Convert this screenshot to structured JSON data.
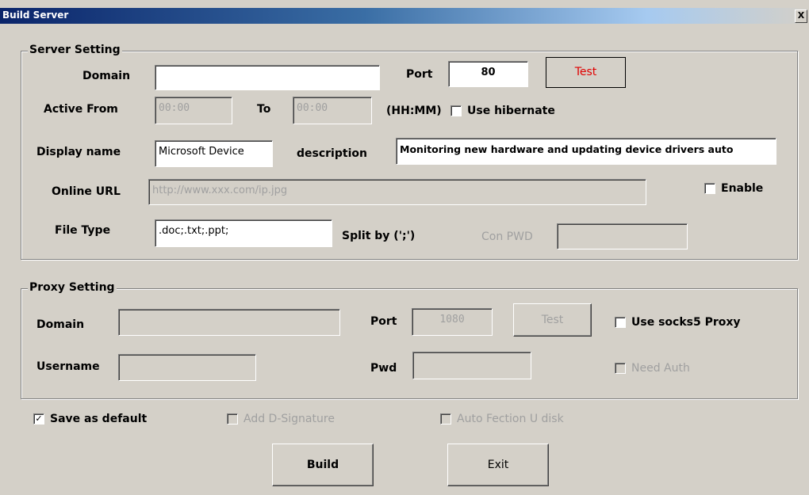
{
  "window": {
    "title": "Build Server",
    "close_glyph": "X"
  },
  "server_setting": {
    "legend": "Server Setting",
    "domain_label": "Domain",
    "domain_value": "",
    "port_label": "Port",
    "port_value": "80",
    "test_label": "Test",
    "active_from_label": "Active From",
    "active_from_value": "00:00",
    "to_label": "To",
    "to_value": "00:00",
    "hhmm_label": "(HH:MM)",
    "use_hibernate_label": "Use hibernate",
    "use_hibernate_checked": false,
    "display_name_label": "Display name",
    "display_name_value": "Microsoft Device",
    "description_label": "description",
    "description_value": "Monitoring new hardware and updating device drivers auto",
    "online_url_label": "Online URL",
    "online_url_value": "http://www.xxx.com/ip.jpg",
    "enable_label": "Enable",
    "enable_checked": false,
    "file_type_label": "File Type",
    "file_type_value": ".doc;.txt;.ppt;",
    "split_by_label": "Split by (';')",
    "con_pwd_label": "Con PWD",
    "con_pwd_value": ""
  },
  "proxy_setting": {
    "legend": "Proxy Setting",
    "domain_label": "Domain",
    "domain_value": "",
    "port_label": "Port",
    "port_value": "1080",
    "test_label": "Test",
    "use_socks5_label": "Use socks5 Proxy",
    "use_socks5_checked": false,
    "username_label": "Username",
    "username_value": "",
    "pwd_label": "Pwd",
    "pwd_value": "",
    "need_auth_label": "Need Auth",
    "need_auth_checked": false
  },
  "options": {
    "save_default_label": "Save as default",
    "save_default_check": "✓",
    "add_signature_label": "Add D-Signature",
    "auto_fection_label": "Auto Fection U disk"
  },
  "buttons": {
    "build_label": "Build",
    "exit_label": "Exit"
  }
}
